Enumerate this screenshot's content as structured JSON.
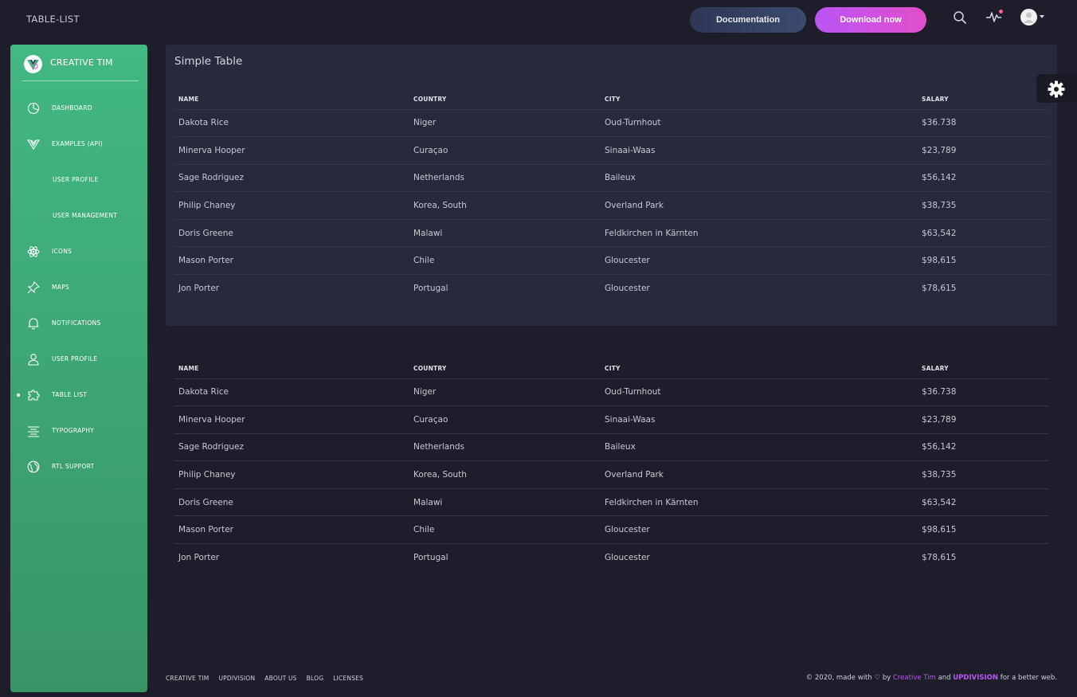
{
  "navbar": {
    "brand": "TABLE-LIST",
    "documentation_label": "Documentation",
    "download_label": "Download now"
  },
  "sidebar": {
    "title": "CREATIVE TIM",
    "items": [
      {
        "label": "DASHBOARD",
        "icon": "chart-pie-icon"
      },
      {
        "label": "EXAMPLES (API)",
        "icon": "vue-logo-icon"
      },
      {
        "label": "USER PROFILE",
        "icon": ""
      },
      {
        "label": "USER MANAGEMENT",
        "icon": ""
      },
      {
        "label": "ICONS",
        "icon": "atom-icon"
      },
      {
        "label": "MAPS",
        "icon": "pin-icon"
      },
      {
        "label": "NOTIFICATIONS",
        "icon": "bell-icon"
      },
      {
        "label": "USER PROFILE",
        "icon": "user-icon"
      },
      {
        "label": "TABLE LIST",
        "icon": "puzzle-icon"
      },
      {
        "label": "TYPOGRAPHY",
        "icon": "align-center-icon"
      },
      {
        "label": "RTL SUPPORT",
        "icon": "world-icon"
      }
    ],
    "active": "TABLE LIST"
  },
  "simple_table": {
    "title": "Simple Table",
    "headers": [
      "NAME",
      "COUNTRY",
      "CITY",
      "SALARY"
    ],
    "rows": [
      [
        "Dakota Rice",
        "Niger",
        "Oud-Turnhout",
        "$36.738"
      ],
      [
        "Minerva Hooper",
        "Curaçao",
        "Sinaai-Waas",
        "$23,789"
      ],
      [
        "Sage Rodriguez",
        "Netherlands",
        "Baileux",
        "$56,142"
      ],
      [
        "Philip Chaney",
        "Korea, South",
        "Overland Park",
        "$38,735"
      ],
      [
        "Doris Greene",
        "Malawi",
        "Feldkirchen in Kärnten",
        "$63,542"
      ],
      [
        "Mason Porter",
        "Chile",
        "Gloucester",
        "$98,615"
      ],
      [
        "Jon Porter",
        "Portugal",
        "Gloucester",
        "$78,615"
      ]
    ]
  },
  "plain_table": {
    "headers": [
      "NAME",
      "COUNTRY",
      "CITY",
      "SALARY"
    ],
    "rows": [
      [
        "Dakota Rice",
        "Niger",
        "Oud-Turnhout",
        "$36.738"
      ],
      [
        "Minerva Hooper",
        "Curaçao",
        "Sinaai-Waas",
        "$23,789"
      ],
      [
        "Sage Rodriguez",
        "Netherlands",
        "Baileux",
        "$56,142"
      ],
      [
        "Philip Chaney",
        "Korea, South",
        "Overland Park",
        "$38,735"
      ],
      [
        "Doris Greene",
        "Malawi",
        "Feldkirchen in Kärnten",
        "$63,542"
      ],
      [
        "Mason Porter",
        "Chile",
        "Gloucester",
        "$98,615"
      ],
      [
        "Jon Porter",
        "Portugal",
        "Gloucester",
        "$78,615"
      ]
    ]
  },
  "footer": {
    "links": [
      "CREATIVE TIM",
      "UPDIVISION",
      "ABOUT US",
      "BLOG",
      "LICENSES"
    ],
    "copyright_prefix": "© 2020, made with",
    "by": "by",
    "creative_tim": "Creative Tim",
    "and": "and",
    "updivision": "UPDIVISION",
    "suffix": "for a better web."
  },
  "colors": {
    "background": "#1e1e2b",
    "card": "#27293d",
    "sidebar_top": "#42b883",
    "sidebar_bottom": "#389466",
    "accent_purple": "#ba54f5",
    "accent_pink": "#e14eca",
    "notification_dot": "#fd5d93"
  }
}
